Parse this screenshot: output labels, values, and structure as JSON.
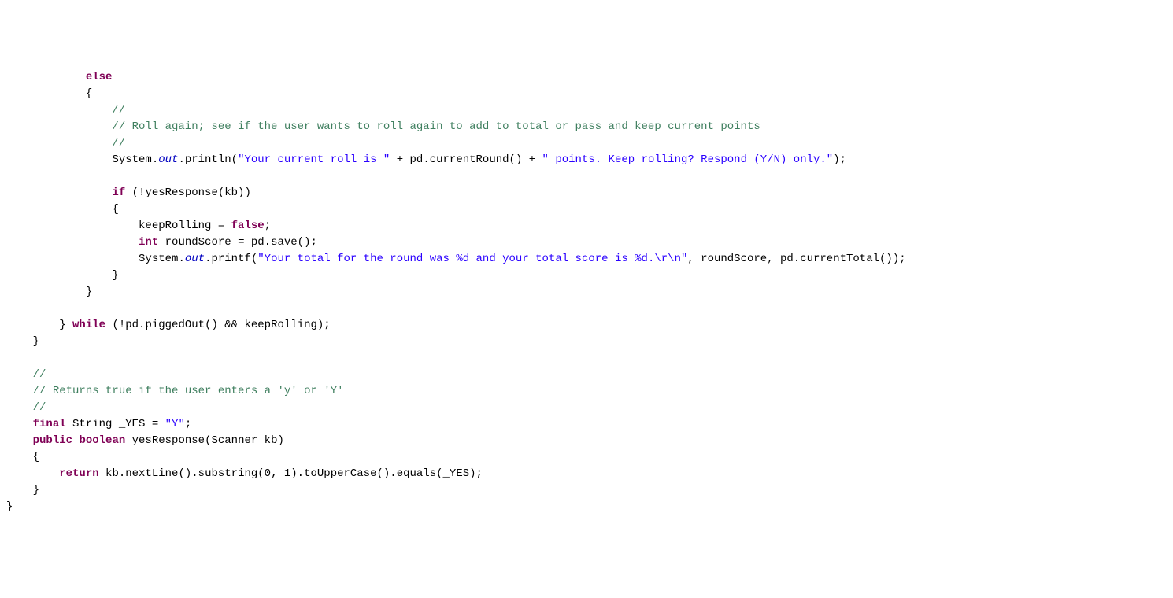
{
  "code": {
    "lines": [
      {
        "indent": 12,
        "tokens": [
          {
            "t": "else",
            "c": "kw"
          }
        ]
      },
      {
        "indent": 12,
        "tokens": [
          {
            "t": "{",
            "c": "plain"
          }
        ]
      },
      {
        "indent": 16,
        "tokens": [
          {
            "t": "//",
            "c": "comment"
          }
        ]
      },
      {
        "indent": 16,
        "tokens": [
          {
            "t": "// Roll again; see if the user wants to roll again to add to total or pass and keep current points",
            "c": "comment"
          }
        ]
      },
      {
        "indent": 16,
        "tokens": [
          {
            "t": "//",
            "c": "comment"
          }
        ]
      },
      {
        "indent": 16,
        "tokens": [
          {
            "t": "System.",
            "c": "plain"
          },
          {
            "t": "out",
            "c": "static-field"
          },
          {
            "t": ".println(",
            "c": "plain"
          },
          {
            "t": "\"Your current roll is \"",
            "c": "str"
          },
          {
            "t": " + pd.currentRound() + ",
            "c": "plain"
          },
          {
            "t": "\" points. Keep rolling? Respond (Y/N) only.\"",
            "c": "str"
          },
          {
            "t": ");",
            "c": "plain"
          }
        ]
      },
      {
        "indent": 0,
        "tokens": []
      },
      {
        "indent": 16,
        "tokens": [
          {
            "t": "if",
            "c": "kw"
          },
          {
            "t": " (!yesResponse(kb))",
            "c": "plain"
          }
        ]
      },
      {
        "indent": 16,
        "tokens": [
          {
            "t": "{",
            "c": "plain"
          }
        ]
      },
      {
        "indent": 20,
        "tokens": [
          {
            "t": "keepRolling = ",
            "c": "plain"
          },
          {
            "t": "false",
            "c": "kw"
          },
          {
            "t": ";",
            "c": "plain"
          }
        ]
      },
      {
        "indent": 20,
        "tokens": [
          {
            "t": "int",
            "c": "kw"
          },
          {
            "t": " roundScore = pd.save();",
            "c": "plain"
          }
        ]
      },
      {
        "indent": 20,
        "tokens": [
          {
            "t": "System.",
            "c": "plain"
          },
          {
            "t": "out",
            "c": "static-field"
          },
          {
            "t": ".printf(",
            "c": "plain"
          },
          {
            "t": "\"Your total for the round was %d and your total score is %d.\\r\\n\"",
            "c": "str"
          },
          {
            "t": ", roundScore, pd.currentTotal());",
            "c": "plain"
          }
        ]
      },
      {
        "indent": 16,
        "tokens": [
          {
            "t": "}",
            "c": "plain"
          }
        ]
      },
      {
        "indent": 12,
        "tokens": [
          {
            "t": "}",
            "c": "plain"
          }
        ]
      },
      {
        "indent": 0,
        "tokens": []
      },
      {
        "indent": 8,
        "tokens": [
          {
            "t": "} ",
            "c": "plain"
          },
          {
            "t": "while",
            "c": "kw"
          },
          {
            "t": " (!pd.piggedOut() && keepRolling);",
            "c": "plain"
          }
        ]
      },
      {
        "indent": 4,
        "tokens": [
          {
            "t": "}",
            "c": "plain"
          }
        ]
      },
      {
        "indent": 0,
        "tokens": []
      },
      {
        "indent": 4,
        "tokens": [
          {
            "t": "//",
            "c": "comment"
          }
        ]
      },
      {
        "indent": 4,
        "tokens": [
          {
            "t": "// Returns true if the user enters a 'y' or 'Y'",
            "c": "comment"
          }
        ]
      },
      {
        "indent": 4,
        "tokens": [
          {
            "t": "//",
            "c": "comment"
          }
        ]
      },
      {
        "indent": 4,
        "tokens": [
          {
            "t": "final",
            "c": "kw"
          },
          {
            "t": " String _YES = ",
            "c": "plain"
          },
          {
            "t": "\"Y\"",
            "c": "str"
          },
          {
            "t": ";",
            "c": "plain"
          }
        ]
      },
      {
        "indent": 4,
        "tokens": [
          {
            "t": "public",
            "c": "kw"
          },
          {
            "t": " ",
            "c": "plain"
          },
          {
            "t": "boolean",
            "c": "kw"
          },
          {
            "t": " yesResponse(Scanner kb)",
            "c": "plain"
          }
        ]
      },
      {
        "indent": 4,
        "tokens": [
          {
            "t": "{",
            "c": "plain"
          }
        ]
      },
      {
        "indent": 8,
        "tokens": [
          {
            "t": "return",
            "c": "kw"
          },
          {
            "t": " kb.nextLine().substring(0, 1).toUpperCase().equals(_YES);",
            "c": "plain"
          }
        ]
      },
      {
        "indent": 4,
        "tokens": [
          {
            "t": "}",
            "c": "plain"
          }
        ]
      },
      {
        "indent": 0,
        "tokens": [
          {
            "t": "}",
            "c": "plain"
          }
        ]
      }
    ]
  }
}
